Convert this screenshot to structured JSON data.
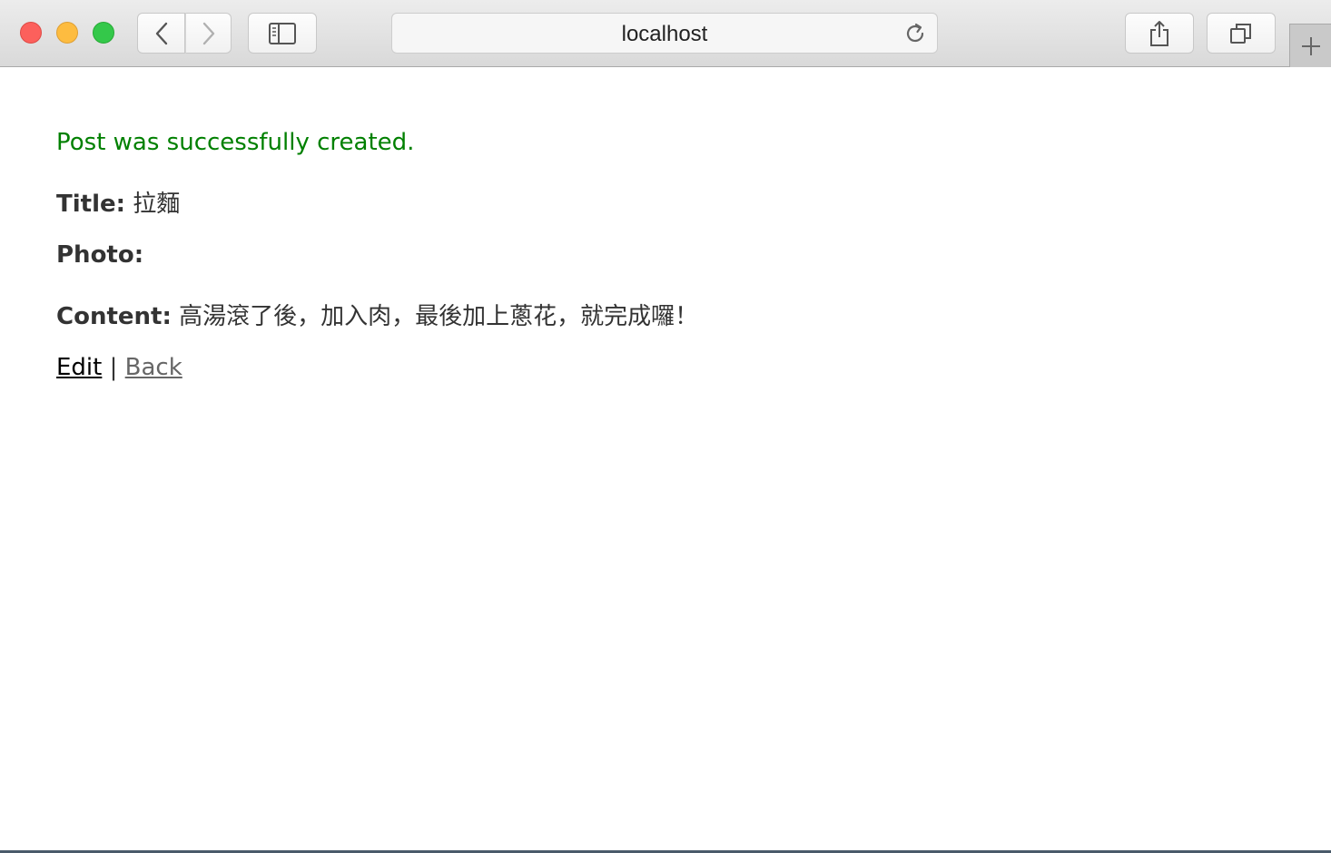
{
  "browser": {
    "url": "localhost",
    "icons": {
      "back": "chevron-left-icon",
      "forward": "chevron-right-icon",
      "sidebar": "sidebar-icon",
      "reload": "reload-icon",
      "share": "share-icon",
      "tabs": "tabs-overview-icon",
      "new_tab": "plus-icon"
    }
  },
  "page": {
    "notice": "Post was successfully created.",
    "notice_color": "#008000",
    "fields": {
      "title_label": "Title:",
      "title_value": "拉麵",
      "photo_label": "Photo:",
      "content_label": "Content:",
      "content_value": "高湯滾了後，加入肉，最後加上蔥花，就完成囉！"
    },
    "links": {
      "edit": "Edit",
      "separator": "|",
      "back": "Back"
    }
  }
}
